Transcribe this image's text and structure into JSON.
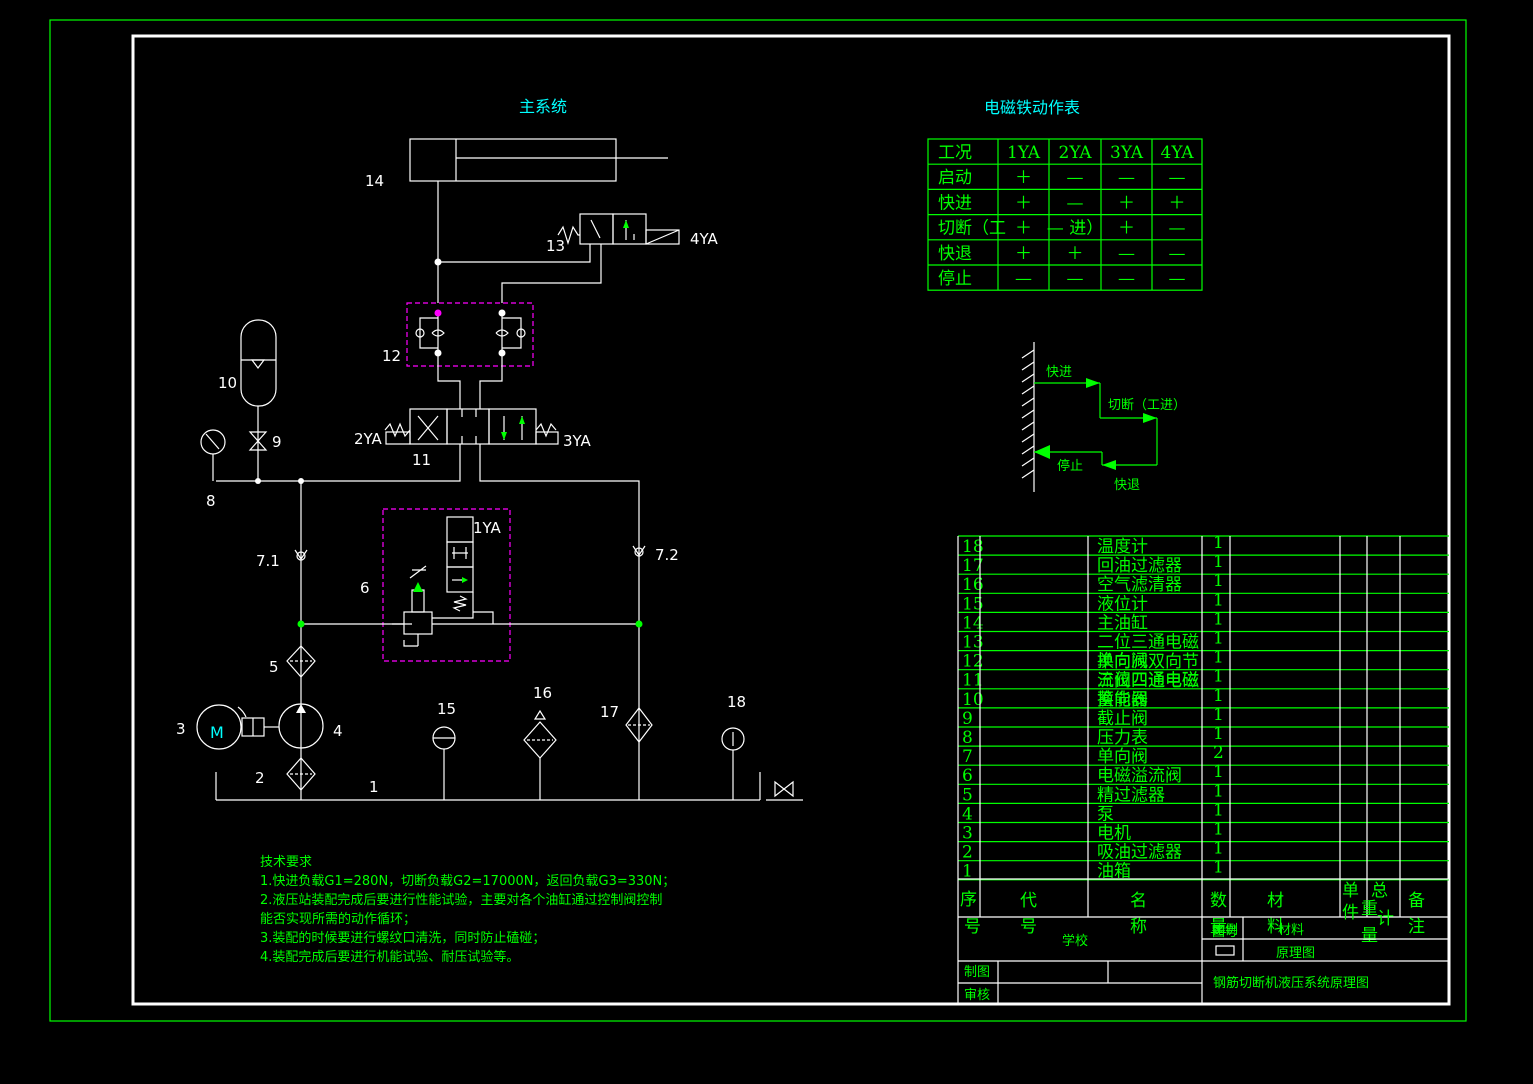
{
  "colors": {
    "background": "#000000",
    "frame": "#ffffff",
    "table": "#00ff00",
    "title": "#00ffff",
    "box": "#ff00ff"
  },
  "main_system_title": "主系统",
  "solenoid_table": {
    "title": "电磁铁动作表",
    "headers": [
      "工况",
      "1YA",
      "2YA",
      "3YA",
      "4YA"
    ],
    "rows": [
      [
        "启动",
        "＋",
        "—",
        "—",
        "—"
      ],
      [
        "快进",
        "＋",
        "—",
        "＋",
        "＋"
      ],
      [
        "切断（工",
        "＋",
        "— 进）",
        "＋",
        "—"
      ],
      [
        "快退",
        "＋",
        "＋",
        "—",
        "—"
      ],
      [
        "停止",
        "—",
        "—",
        "—",
        "—"
      ]
    ]
  },
  "cycle_chart": {
    "fast_forward": "快进",
    "cutting": "切断（工进）",
    "stop": "停止",
    "fast_return": "快退"
  },
  "labels": {
    "n14": "14",
    "n13": "13",
    "ya4": "4YA",
    "n12": "12",
    "n10": "10",
    "n9": "9",
    "ya2": "2YA",
    "n11": "11",
    "ya3": "3YA",
    "n8": "8",
    "n71": "7.1",
    "n72": "7.2",
    "ya1": "1YA",
    "n6": "6",
    "n5": "5",
    "n3": "3",
    "motor": "M",
    "n4": "4",
    "n2": "2",
    "n1": "1",
    "n15": "15",
    "n16": "16",
    "n17": "17",
    "n18": "18"
  },
  "tech_requirements": {
    "title": "技术要求",
    "lines": [
      "1.快进负载G1=280N，切断负载G2=17000N，返回负载G3=330N；",
      "2.液压站装配完成后要进行性能试验，主要对各个油缸通过控制阀控制",
      "能否实现所需的动作循环；",
      "3.装配的时候要进行螺纹口清洗，同时防止磕碰；",
      "4.装配完成后要进行机能试验、耐压试验等。"
    ]
  },
  "parts_list": [
    {
      "no": "18",
      "name": "温度计",
      "qty": "1"
    },
    {
      "no": "17",
      "name": "回油过滤器",
      "qty": "1"
    },
    {
      "no": "16",
      "name": "空气滤清器",
      "qty": "1"
    },
    {
      "no": "15",
      "name": "液位计",
      "qty": "1"
    },
    {
      "no": "14",
      "name": "主油缸",
      "qty": "1"
    },
    {
      "no": "13",
      "name": "二位三通电磁",
      "qty": "1"
    },
    {
      "no": "12",
      "name": "换向阀",
      "qty": "1"
    },
    {
      "no": "11",
      "name": "三位四通电磁",
      "qty": "1"
    },
    {
      "no": "10",
      "name": "蓄能器",
      "qty": "1"
    },
    {
      "no": "9",
      "name": "截止阀",
      "qty": "1"
    },
    {
      "no": "8",
      "name": "压力表",
      "qty": "1"
    },
    {
      "no": "7",
      "name": "单向阀",
      "qty": "2"
    },
    {
      "no": "6",
      "name": "电磁溢流阀",
      "qty": "1"
    },
    {
      "no": "5",
      "name": "精过滤器",
      "qty": "1"
    },
    {
      "no": "4",
      "name": "泵",
      "qty": "1"
    },
    {
      "no": "3",
      "name": "电机",
      "qty": "1"
    },
    {
      "no": "2",
      "name": "吸油过滤器",
      "qty": "1"
    },
    {
      "no": "1",
      "name": "油箱",
      "qty": "1"
    }
  ],
  "parts_overlap_text": [
    "单向减双向节",
    "流阀四通电磁",
    "换向阀"
  ],
  "parts_header": {
    "seq": "序",
    "seq2": "号",
    "code": "代",
    "code2": "号",
    "name": "名",
    "name2": "称",
    "qty": "数",
    "mat": "材",
    "mat2": "料",
    "unit": "单",
    "unit2": "件",
    "total": "总",
    "total2": "重",
    "total3": "计",
    "total4": "量",
    "remark": "备",
    "remark2": "注",
    "qty2": "量"
  },
  "title_block": {
    "school": "学校",
    "scale": "比例",
    "material": "材料",
    "ratio": "图号",
    "drawing_type": "原理图",
    "drawn": "制图",
    "checked": "审核",
    "title": "钢筋切断机液压系统原理图"
  }
}
